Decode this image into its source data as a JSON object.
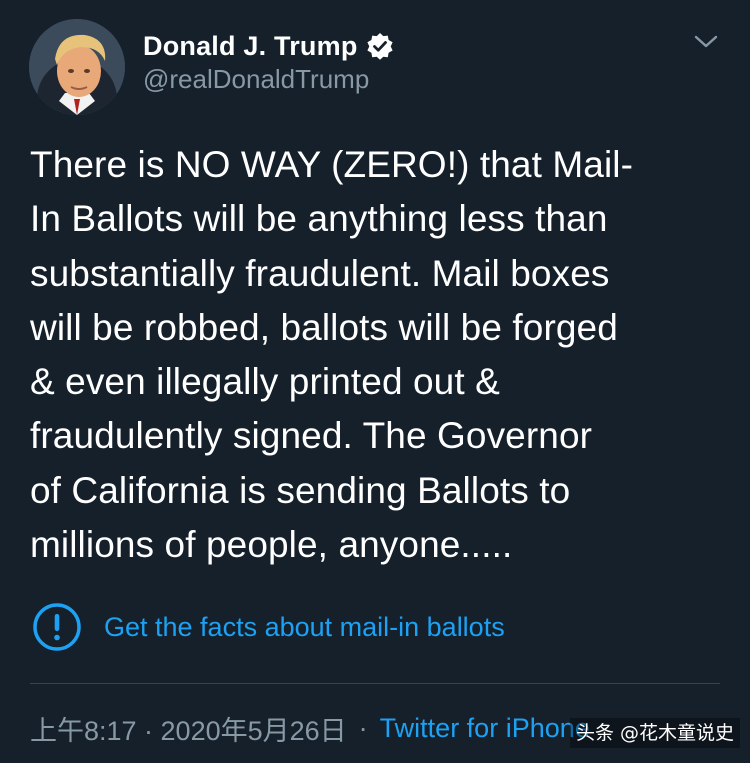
{
  "tweet": {
    "display_name": "Donald J. Trump",
    "handle": "@realDonaldTrump",
    "verified": true,
    "text": "There is NO WAY (ZERO!) that Mail-\nIn Ballots will be anything less than\nsubstantially fraudulent. Mail boxes\nwill be robbed, ballots will be forged\n& even illegally printed out &\nfraudulently signed. The Governor\nof California is sending Ballots to\nmillions of people, anyone.....",
    "facts_link": "Get the facts about mail-in ballots",
    "timestamp": "上午8:17 · 2020年5月26日",
    "separator": "·",
    "source": "Twitter for iPhone"
  },
  "watermark": "头条 @花木童说史",
  "colors": {
    "background": "#15202b",
    "accent": "#1da1f2",
    "secondary_text": "#8899a6",
    "divider": "#38444d"
  },
  "icons": {
    "avatar": "profile-photo",
    "verified": "verified-badge-icon",
    "menu": "chevron-down-icon",
    "info": "exclamation-circle-icon"
  }
}
